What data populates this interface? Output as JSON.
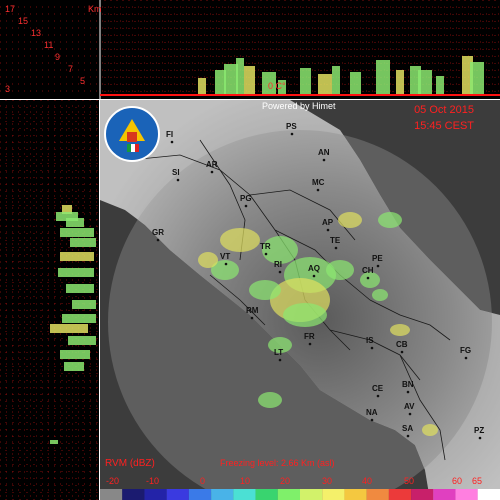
{
  "header": {
    "altitude_ticks": [
      "17",
      "15",
      "13",
      "11",
      "9",
      "7",
      "5",
      "3"
    ],
    "altitude_unit": "Km",
    "freezing_marker": "0 C°"
  },
  "map": {
    "powered_by": "Powered by Himet",
    "date": "05 Oct 2015",
    "time": "15:45 CEST",
    "cities": [
      "FI",
      "PS",
      "AN",
      "SI",
      "AR",
      "MC",
      "PG",
      "GR",
      "AP",
      "TE",
      "TR",
      "RI",
      "AQ",
      "VT",
      "PE",
      "CH",
      "RM",
      "FR",
      "FG",
      "IS",
      "CB",
      "LT",
      "CE",
      "BN",
      "NA",
      "AV",
      "SA",
      "PZ"
    ]
  },
  "footer": {
    "product_label": "RVM (dBZ)",
    "freezing_level": "Freezing level: 2.66 Km (asl)",
    "scale_values": [
      "-20",
      "-10",
      "0",
      "10",
      "20",
      "30",
      "40",
      "50",
      "60",
      "65"
    ],
    "colors": [
      "#888888",
      "#1b1b70",
      "#2323a8",
      "#3a3ae0",
      "#3a7ae8",
      "#49b3e8",
      "#4be0d4",
      "#39d46f",
      "#7ff06a",
      "#d2f26a",
      "#f4f06a",
      "#f4c840",
      "#f08a40",
      "#ec3a3a",
      "#c8206a",
      "#e040c0",
      "#ff7fe0",
      "#ffffff"
    ]
  },
  "colors": {
    "label_red": "#ff2020",
    "header_line": "#ff1111",
    "echo_green": "#8be870",
    "echo_yellow": "#e0e060",
    "echo_cyan": "#60c8d8"
  }
}
